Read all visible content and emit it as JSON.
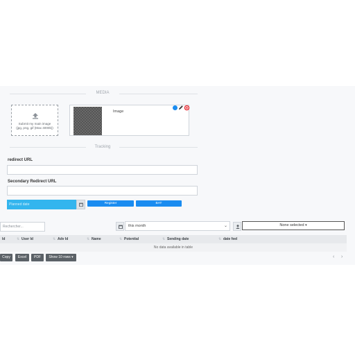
{
  "media_section": {
    "title": "MEDIA",
    "upload_text_line1": "Submit my main image",
    "upload_text_line2": "(jpg, png, gif (Max 4000k))",
    "image_label": "Image"
  },
  "tracking_section": {
    "title": "Tracking",
    "redirect_label": "redirect URL",
    "redirect_value": "",
    "secondary_label": "Secondary Redirect URL",
    "secondary_value": ""
  },
  "actions": {
    "date_placeholder": "Planned date",
    "register_label": "Register",
    "bat_label": "BAT"
  },
  "filters": {
    "search_placeholder": "Rechercher...",
    "period_value": "this month",
    "user_select_value": "None selected"
  },
  "table": {
    "columns": [
      "Id",
      "User Id",
      "Adv Id",
      "Name",
      "Potential",
      "Sending date",
      "date feel"
    ],
    "empty_message": "No data available in table"
  },
  "export": {
    "copy_label": "Copy",
    "excel_label": "Excel",
    "pdf_label": "PDF",
    "rows_label": "Show 10 rows"
  },
  "pagination": {
    "prev": "‹",
    "next": "›"
  },
  "colors": {
    "primary_button": "#1a8cf0",
    "date_field": "#33b5ee",
    "edit_icon": "#1a8cf0",
    "delete_icon": "#e8333a",
    "export_button": "#5b6167"
  }
}
